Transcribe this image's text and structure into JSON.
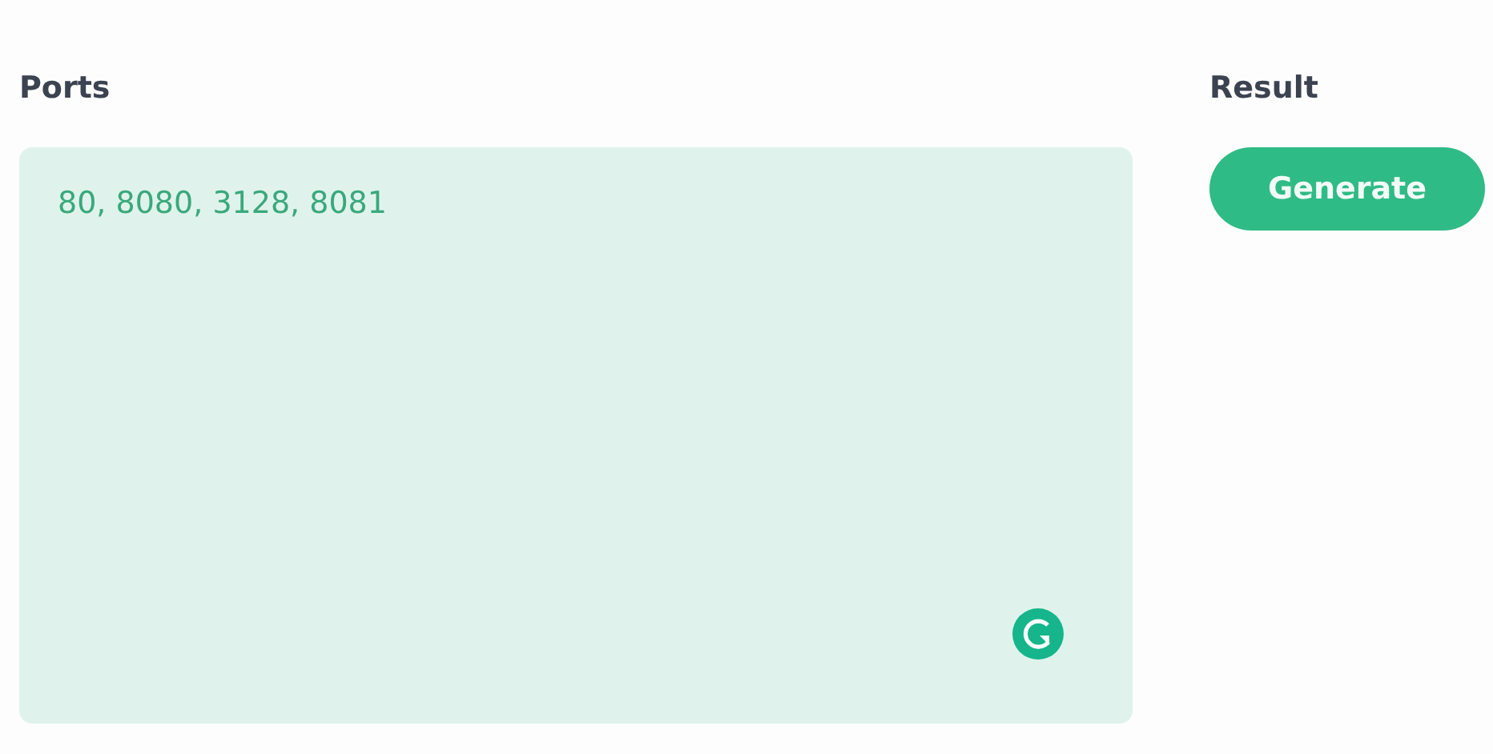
{
  "ports": {
    "label": "Ports",
    "value": "80, 8080, 3128, 8081"
  },
  "result": {
    "label": "Result",
    "button": "Generate"
  }
}
